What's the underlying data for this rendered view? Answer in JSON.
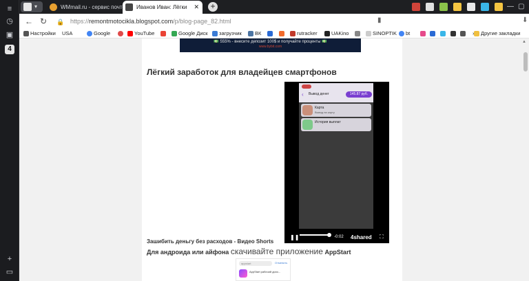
{
  "tabs": [
    {
      "title": "WMmail.ru - сервис почто"
    },
    {
      "title": "Иванов Иван: Лёгки"
    }
  ],
  "sidebar": {
    "badge": "4"
  },
  "address": {
    "host": "remontmotocikla.blogspot.com",
    "path": "/p/blog-page_82.html"
  },
  "bookmarks": [
    {
      "label": "Настройки",
      "color": "#555555"
    },
    {
      "label": "USA",
      "color": "#ffffff"
    },
    {
      "label": "Google",
      "color": "#4285f4"
    },
    {
      "label": "",
      "color": "#e04a4a"
    },
    {
      "label": "YouTube",
      "color": "#ff0000"
    },
    {
      "label": "",
      "color": "#ea4335"
    },
    {
      "label": "Google Диск",
      "color": "#34a853"
    },
    {
      "label": "загрузчик",
      "color": "#3a7bd5"
    },
    {
      "label": "ВК",
      "color": "#4c75a3"
    },
    {
      "label": "",
      "color": "#2a6ad4"
    },
    {
      "label": "",
      "color": "#f26b2c"
    },
    {
      "label": "rutracker",
      "color": "#c0392b"
    },
    {
      "label": "UAKino",
      "color": "#222222"
    },
    {
      "label": "",
      "color": "#888888"
    },
    {
      "label": "SINOPTIK",
      "color": "#cccccc"
    },
    {
      "label": "bt",
      "color": "#4285f4"
    },
    {
      "label": "Другие закладки",
      "color": "#f0c040"
    }
  ],
  "ad": {
    "line1": "💵 555% - внесите депозит 100$ и получайте проценты 💵",
    "line2": "www.bybit.com"
  },
  "post": {
    "title": "Лёгкий заработок для владейцев смартфонов",
    "caption": "Зашибить деньгу без расходов - Видео Shorts",
    "line2_prefix": "Для андроида или айфона ",
    "line2_big": "скачивайте приложение",
    "line2_suffix": " AppStart"
  },
  "video": {
    "screen_title": "Вывод денег",
    "amount": "145.87 руб.",
    "card1_title": "Карта",
    "card1_sub": "Вывод на карту",
    "card2_title": "История выплат",
    "time": "-0:02",
    "brand": "4shared"
  },
  "shot": {
    "search": "appstart",
    "cancel": "Отменить",
    "app": "AppStart рабочий дохо..."
  }
}
